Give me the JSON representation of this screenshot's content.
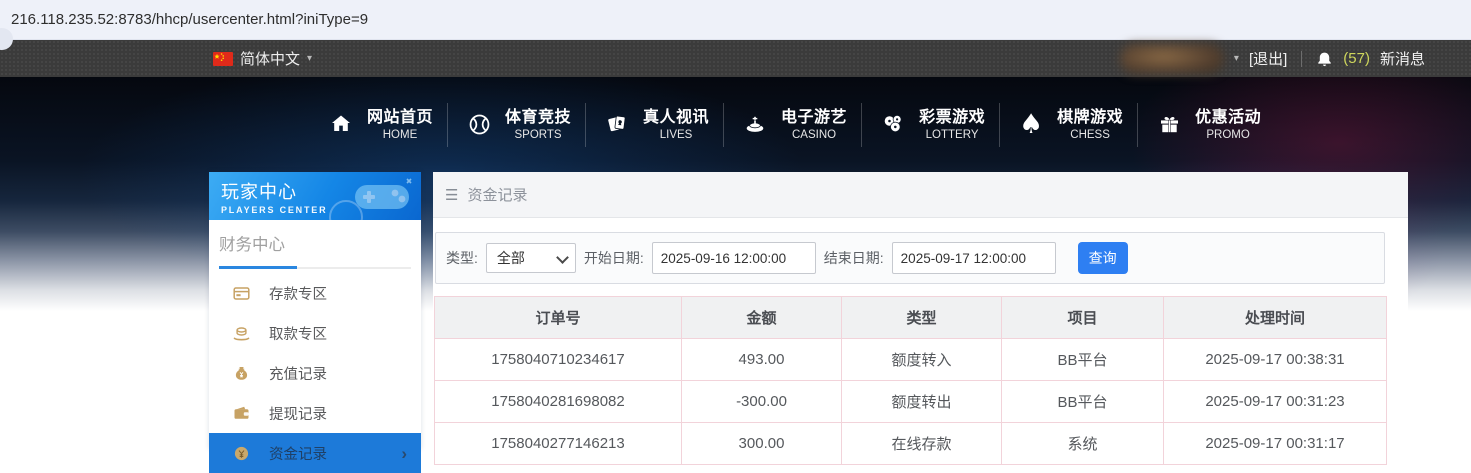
{
  "browser": {
    "url": "216.118.235.52:8783/hhcp/usercenter.html?iniType=9"
  },
  "topbar": {
    "language_label": "简体中文",
    "logout_label": "[退出]",
    "message_count": "(57)",
    "message_label": "新消息"
  },
  "icons": {
    "hamburger": "☰",
    "caret_down": "▾",
    "chevron_right": "›",
    "spade": "♠"
  },
  "nav": {
    "items": [
      {
        "zh": "网站首页",
        "en": "HOME",
        "icon": "home-icon"
      },
      {
        "zh": "体育竞技",
        "en": "SPORTS",
        "icon": "basketball-icon"
      },
      {
        "zh": "真人视讯",
        "en": "LIVES",
        "icon": "playing-cards-icon"
      },
      {
        "zh": "电子游艺",
        "en": "CASINO",
        "icon": "roulette-icon"
      },
      {
        "zh": "彩票游戏",
        "en": "LOTTERY",
        "icon": "lottery-balls-icon"
      },
      {
        "zh": "棋牌游戏",
        "en": "CHESS",
        "icon": "spade-icon"
      },
      {
        "zh": "优惠活动",
        "en": "PROMO",
        "icon": "gift-icon"
      }
    ]
  },
  "sidebar": {
    "title": "玩家中心",
    "subtitle": "PLAYERS CENTER",
    "section_title": "财务中心",
    "items": [
      {
        "label": "存款专区",
        "icon": "deposit-icon",
        "active": false
      },
      {
        "label": "取款专区",
        "icon": "withdraw-icon",
        "active": false
      },
      {
        "label": "充值记录",
        "icon": "recharge-record-icon",
        "active": false
      },
      {
        "label": "提现记录",
        "icon": "withdraw-record-icon",
        "active": false
      },
      {
        "label": "资金记录",
        "icon": "fund-record-icon",
        "active": true
      }
    ]
  },
  "main": {
    "breadcrumb": "资金记录",
    "filter": {
      "type_label": "类型:",
      "type_value": "全部",
      "start_label": "开始日期:",
      "start_value": "2025-09-16 12:00:00",
      "end_label": "结束日期:",
      "end_value": "2025-09-17 12:00:00",
      "search_label": "查询"
    },
    "table": {
      "headers": [
        "订单号",
        "金额",
        "类型",
        "项目",
        "处理时间"
      ],
      "rows": [
        [
          "1758040710234617",
          "493.00",
          "额度转入",
          "BB平台",
          "2025-09-17 00:38:31"
        ],
        [
          "1758040281698082",
          "-300.00",
          "额度转出",
          "BB平台",
          "2025-09-17 00:31:23"
        ],
        [
          "1758040277146213",
          "300.00",
          "在线存款",
          "系统",
          "2025-09-17 00:31:17"
        ]
      ]
    }
  },
  "colors": {
    "accent_blue": "#1d7ad9",
    "button_blue": "#2e7ff2",
    "sidebar_header_blue_top": "#3dacf4",
    "sidebar_header_blue_bottom": "#0a67d0",
    "gold_icon": "#c7a264",
    "message_count_yellow": "#ced65c",
    "table_border_pink": "#f2d3da",
    "toolbar_dark": "#3b3b3b"
  }
}
